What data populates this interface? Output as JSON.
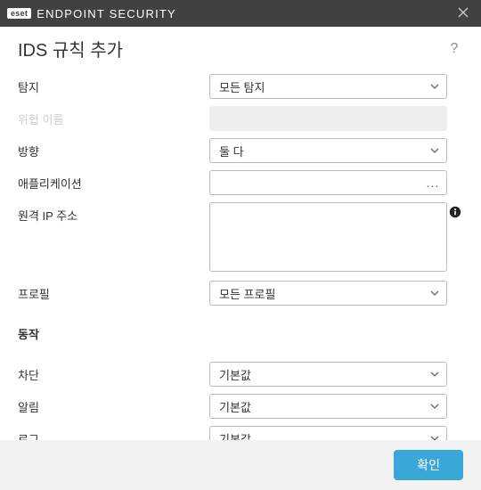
{
  "titlebar": {
    "badge": "eset",
    "title": "ENDPOINT SECURITY"
  },
  "header": {
    "page_title": "IDS 규칙 추가",
    "help": "?"
  },
  "form": {
    "detect_label": "탐지",
    "detect_value": "모든 탐지",
    "threat_name_label": "위협 이름",
    "threat_name_value": "",
    "direction_label": "방향",
    "direction_value": "둘 다",
    "application_label": "애플리케이션",
    "application_value": "",
    "browse_dots": "...",
    "remote_ip_label": "원격 IP 주소",
    "remote_ip_value": "",
    "profile_label": "프로필",
    "profile_value": "모든 프로필"
  },
  "action": {
    "heading": "동작",
    "block_label": "차단",
    "block_value": "기본값",
    "alert_label": "알림",
    "alert_value": "기본값",
    "log_label": "로그",
    "log_value": "기본값"
  },
  "footer": {
    "ok_label": "확인"
  }
}
